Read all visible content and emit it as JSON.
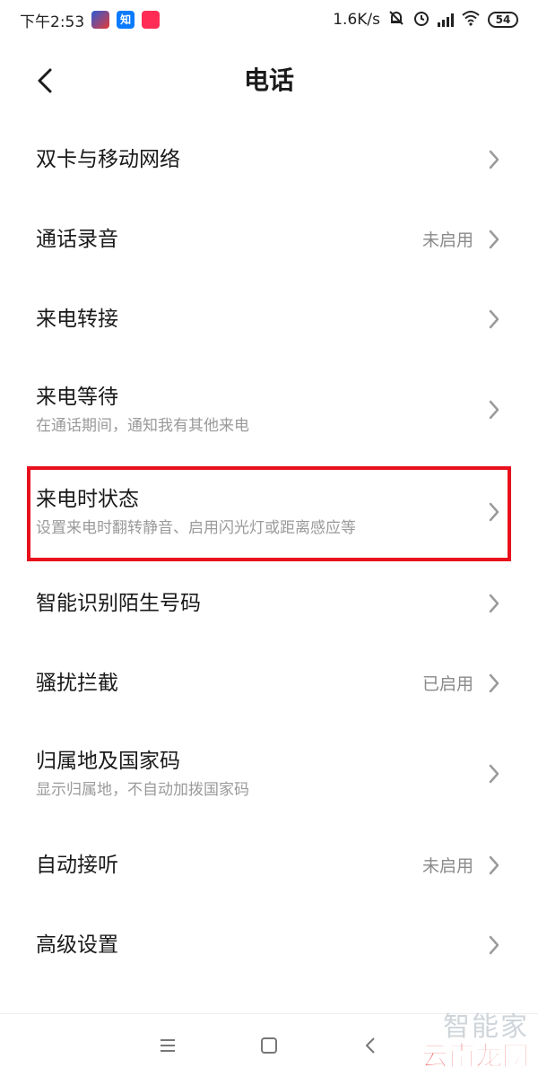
{
  "status_bar": {
    "time": "下午2:53",
    "app_icons": [
      "news-app-icon",
      "zhihu-app-icon",
      "tmall-app-icon"
    ],
    "zhihu_glyph": "知",
    "net_speed": "1.6K/s",
    "status_icons": [
      "mute-bell-icon",
      "alarm-icon",
      "signal-icon",
      "wifi-icon"
    ],
    "battery": "54"
  },
  "header": {
    "title": "电话",
    "back_icon": "chevron-left-icon"
  },
  "items": [
    {
      "title": "双卡与移动网络",
      "sub": "",
      "value": ""
    },
    {
      "title": "通话录音",
      "sub": "",
      "value": "未启用"
    },
    {
      "title": "来电转接",
      "sub": "",
      "value": ""
    },
    {
      "title": "来电等待",
      "sub": "在通话期间，通知我有其他来电",
      "value": ""
    },
    {
      "title": "来电时状态",
      "sub": "设置来电时翻转静音、启用闪光灯或距离感应等",
      "value": ""
    },
    {
      "title": "智能识别陌生号码",
      "sub": "",
      "value": ""
    },
    {
      "title": "骚扰拦截",
      "sub": "",
      "value": "已启用"
    },
    {
      "title": "归属地及国家码",
      "sub": "显示归属地，不自动加拨国家码",
      "value": ""
    },
    {
      "title": "自动接听",
      "sub": "",
      "value": "未启用"
    },
    {
      "title": "高级设置",
      "sub": "",
      "value": ""
    }
  ],
  "highlight_color": "#e8101c",
  "nav_bar": {
    "icons": [
      "menu-icon",
      "home-square-icon",
      "back-triangle-icon"
    ]
  },
  "watermark": {
    "top": "智能家",
    "bottom": "云南龙网"
  }
}
